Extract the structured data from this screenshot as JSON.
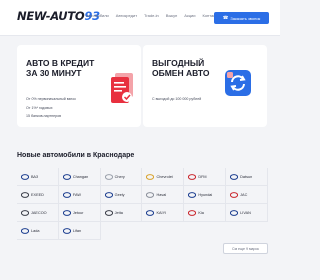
{
  "header": {
    "logo_main": "NEW-AUTO",
    "logo_num": "93",
    "nav": [
      "Автомобили",
      "Автокредит",
      "Trade-in",
      "Выкуп",
      "Акции",
      "Контакты"
    ],
    "cta_label": "Заказать звонок",
    "accent": "#2b6ee6"
  },
  "promos": [
    {
      "title": "Авто в кредит за 30 минут",
      "lines": [
        "От 0% первоначальный взнос",
        "От 1%* годовых",
        "15 банков-партнеров"
      ],
      "illustration": "document-check-icon",
      "accent": "#e8303f"
    },
    {
      "title": "Выгодный обмен авто",
      "lines": [
        "С выгодой до 100 000 рублей"
      ],
      "illustration": "exchange-arrows-icon",
      "accent": "#2b6ee6"
    }
  ],
  "section": {
    "title": "Новые автомобили в Краснодаре"
  },
  "brands": [
    {
      "name": "ВАЗ",
      "icon": "lada-icon",
      "color": "#1b3d8f"
    },
    {
      "name": "Changan",
      "icon": "changan-icon",
      "color": "#1b3d8f"
    },
    {
      "name": "Chery",
      "icon": "chery-icon",
      "color": "#9aa0ab"
    },
    {
      "name": "Chevrolet",
      "icon": "chevrolet-icon",
      "color": "#d8a22b"
    },
    {
      "name": "DFM",
      "icon": "dfm-icon",
      "color": "#c9252c"
    },
    {
      "name": "Datsun",
      "icon": "datsun-icon",
      "color": "#1b3d8f"
    },
    {
      "name": "EXEED",
      "icon": "exeed-icon",
      "color": "#3a3d48"
    },
    {
      "name": "FAW",
      "icon": "faw-icon",
      "color": "#1b3d8f"
    },
    {
      "name": "Geely",
      "icon": "geely-icon",
      "color": "#1b3d8f"
    },
    {
      "name": "Haval",
      "icon": "haval-icon",
      "color": "#8a8f9a"
    },
    {
      "name": "Hyundai",
      "icon": "hyundai-icon",
      "color": "#1b3d8f"
    },
    {
      "name": "JAC",
      "icon": "jac-icon",
      "color": "#c9252c"
    },
    {
      "name": "JAECOO",
      "icon": "jaecoo-icon",
      "color": "#3a3d48"
    },
    {
      "name": "Jetour",
      "icon": "jetour-icon",
      "color": "#1b3d8f"
    },
    {
      "name": "Jetta",
      "icon": "jetta-icon",
      "color": "#3a3d48"
    },
    {
      "name": "KAIYI",
      "icon": "kaiyi-icon",
      "color": "#1b3d8f"
    },
    {
      "name": "Kia",
      "icon": "kia-icon",
      "color": "#c9252c"
    },
    {
      "name": "LIVAN",
      "icon": "livan-icon",
      "color": "#1b3d8f"
    },
    {
      "name": "Lada",
      "icon": "lada-boat-icon",
      "color": "#1b3d8f"
    },
    {
      "name": "Lifan",
      "icon": "lifan-icon",
      "color": "#1b3d8f"
    }
  ],
  "show_all_label": "См еще 9 марок"
}
